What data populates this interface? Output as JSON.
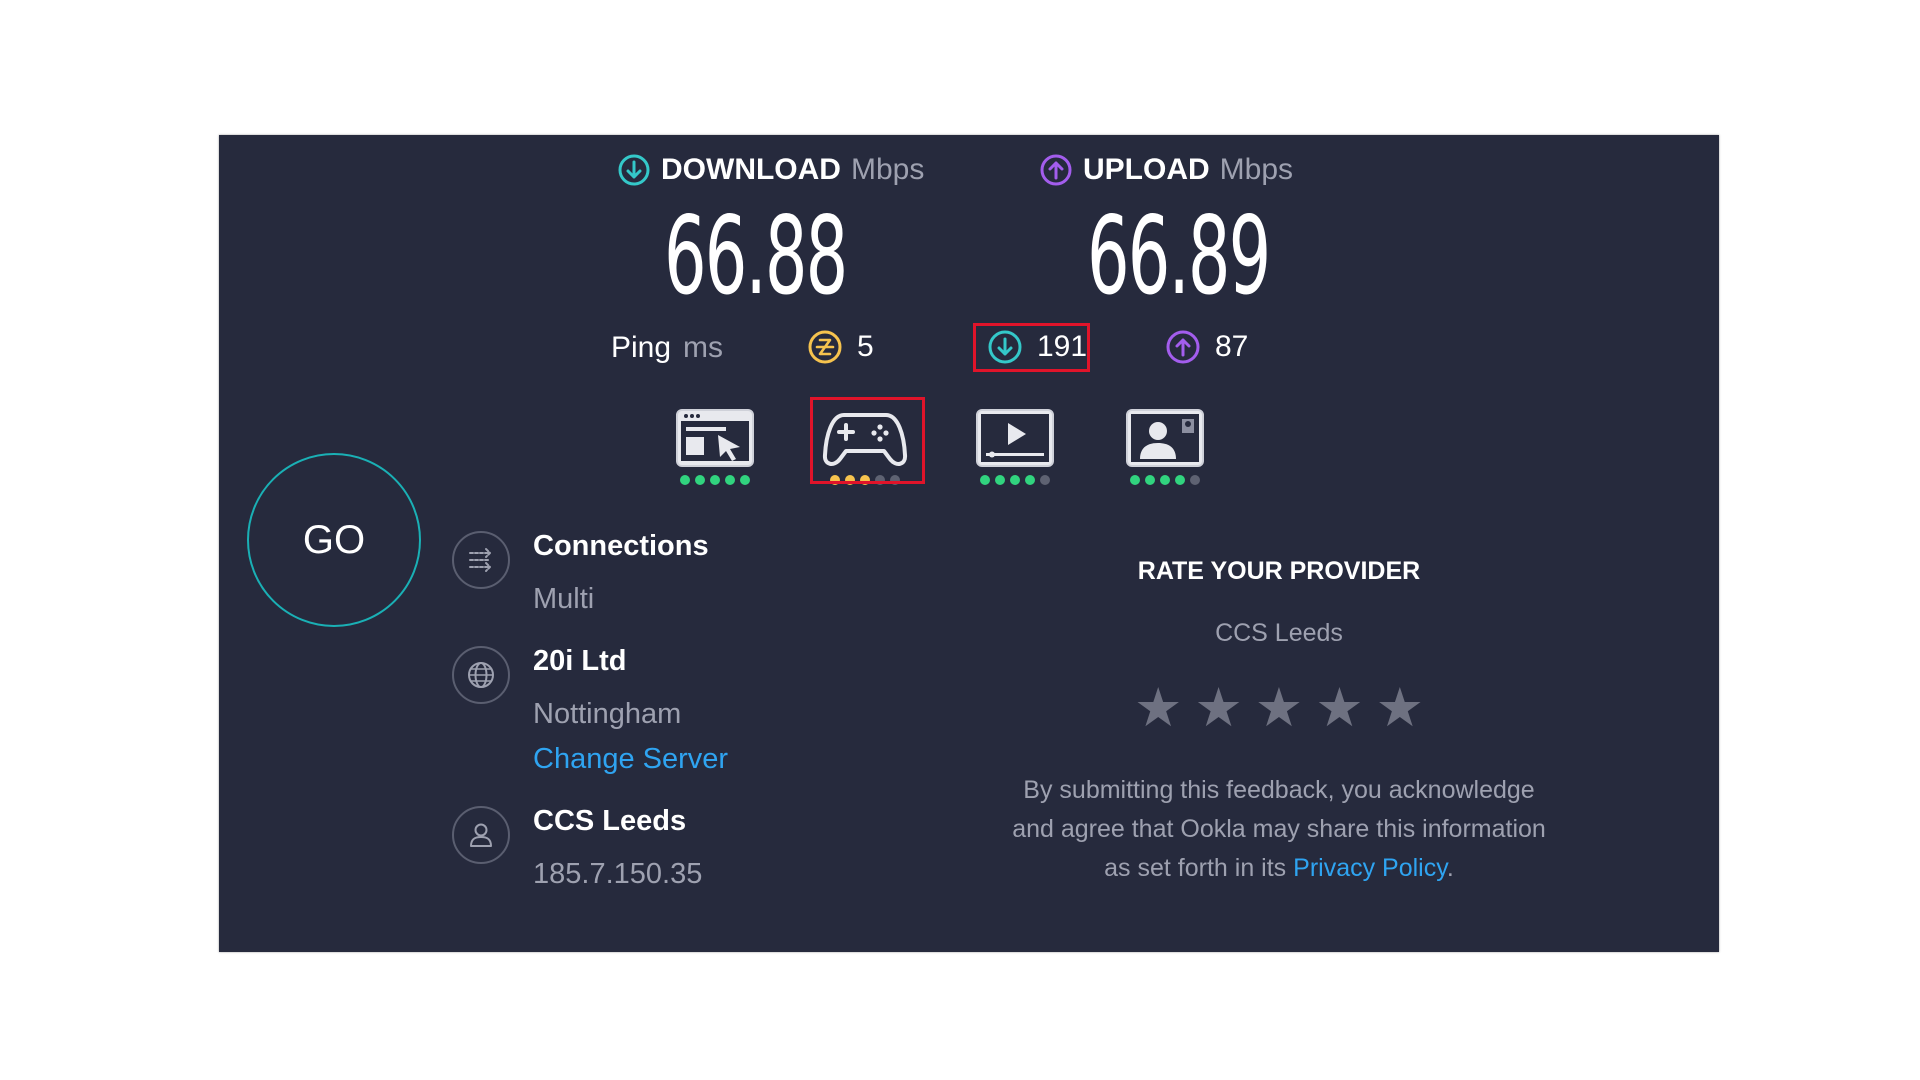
{
  "download": {
    "label": "DOWNLOAD",
    "unit": "Mbps",
    "value": "66.88",
    "icon": "download-arrow-icon",
    "color": "#34c8c9"
  },
  "upload": {
    "label": "UPLOAD",
    "unit": "Mbps",
    "value": "66.89",
    "icon": "upload-arrow-icon",
    "color": "#a35ded"
  },
  "ping": {
    "label": "Ping",
    "unit": "ms",
    "idle": "5",
    "download": "191",
    "upload": "87",
    "idle_color": "#f6c34e"
  },
  "usecases": [
    {
      "name": "web-browsing-icon",
      "rating": 5,
      "max": 5,
      "color": "#31d37f"
    },
    {
      "name": "gaming-controller-icon",
      "rating": 3,
      "max": 5,
      "color": "#f6c34e"
    },
    {
      "name": "video-streaming-icon",
      "rating": 4,
      "max": 5,
      "color": "#31d37f"
    },
    {
      "name": "video-call-icon",
      "rating": 4,
      "max": 5,
      "color": "#31d37f"
    }
  ],
  "go_label": "GO",
  "connections": {
    "title": "Connections",
    "value": "Multi",
    "icon": "connections-icon"
  },
  "server": {
    "title": "20i Ltd",
    "location": "Nottingham",
    "change_label": "Change Server",
    "icon": "globe-icon"
  },
  "provider": {
    "title": "CCS Leeds",
    "ip": "185.7.150.35",
    "icon": "user-icon"
  },
  "rate": {
    "title": "RATE YOUR PROVIDER",
    "provider": "CCS Leeds",
    "stars": 5,
    "disclaimer_text": "By submitting this feedback, you acknowledge and agree that Ookla may share this information as set forth in its",
    "privacy_link": "Privacy Policy",
    "disclaimer_end": "."
  },
  "colors": {
    "panel_bg": "#262a3d",
    "highlight": "#e0142a",
    "link": "#2fa4f1",
    "go_ring": "#1ab0b5",
    "inactive_dot": "#5e6272"
  }
}
